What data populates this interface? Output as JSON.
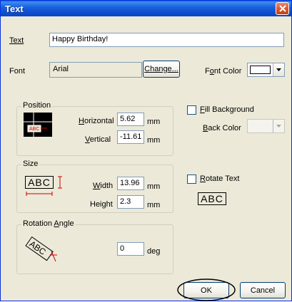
{
  "window": {
    "title": "Text"
  },
  "text_field": {
    "label": "Text",
    "value": "Happy Birthday!"
  },
  "font": {
    "label": "Font",
    "value": "Arial",
    "change_label": "Change...",
    "color_label": "Font Color",
    "color": "#ffffff"
  },
  "position": {
    "group_title": "Position",
    "horizontal_label": "Horizontal",
    "horizontal_value": "5.62",
    "vertical_label": "Vertical",
    "vertical_value": "-11.61",
    "unit": "mm",
    "fill_background_label": "Fill Background",
    "fill_background_checked": false,
    "back_color_label": "Back Color"
  },
  "size": {
    "group_title": "Size",
    "preview_text": "ABC",
    "width_label": "Width",
    "width_value": "13.96",
    "height_label": "Height",
    "height_value": "2.3",
    "unit": "mm",
    "rotate_text_label": "Rotate Text",
    "rotate_text_checked": false,
    "rotate_preview_text": "ABC"
  },
  "rotation": {
    "group_title": "Rotation Angle",
    "preview_text": "ABC",
    "value": "0",
    "unit": "deg"
  },
  "buttons": {
    "ok_label": "OK",
    "cancel_label": "Cancel"
  },
  "colors": {
    "titlebar": "#0a46c0",
    "dialog_bg": "#ece9d8",
    "box_border": "#7f9db9",
    "dimension_red": "#d00000"
  }
}
